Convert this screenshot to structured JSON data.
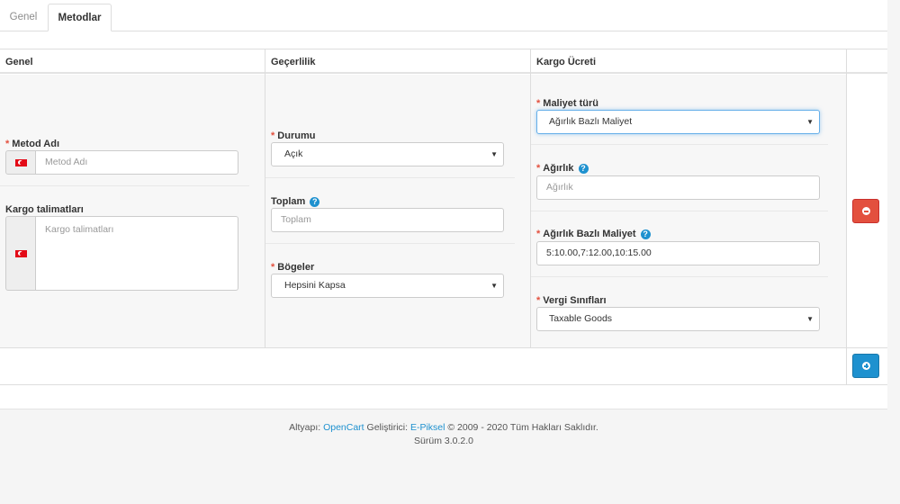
{
  "tabs": [
    {
      "label": "Genel",
      "active": false
    },
    {
      "label": "Metodlar",
      "active": true
    }
  ],
  "table": {
    "headers": [
      "Genel",
      "Geçerlilik",
      "Kargo Ücreti"
    ]
  },
  "genel": {
    "method_name_label": "Metod Adı",
    "method_name_placeholder": "Metod Adı",
    "instructions_label": "Kargo talimatları",
    "instructions_placeholder": "Kargo talimatları"
  },
  "gecerlilik": {
    "status_label": "Durumu",
    "status_value": "Açık",
    "total_label": "Toplam",
    "total_placeholder": "Toplam",
    "regions_label": "Bögeler",
    "regions_value": "Hepsini Kapsa"
  },
  "kargo": {
    "cost_type_label": "Maliyet türü",
    "cost_type_value": "Ağırlık Bazlı Maliyet",
    "weight_label": "Ağırlık",
    "weight_placeholder": "Ağırlık",
    "weight_cost_label": "Ağırlık Bazlı Maliyet",
    "weight_cost_value": "5:10.00,7:12.00,10:15.00",
    "tax_class_label": "Vergi Sınıfları",
    "tax_class_value": "Taxable Goods"
  },
  "icons": {
    "flag": "turkey-flag-icon",
    "help": "question-circle-icon",
    "remove": "minus-circle-icon",
    "add": "plus-circle-icon",
    "select": "caret-down-icon"
  },
  "colors": {
    "danger": "#e3503e",
    "primary": "#1e91cf",
    "required": "#e3503e"
  },
  "footer": {
    "prefix": "Altyapı: ",
    "opencart": "OpenCart",
    "middle": " Geliştirici: ",
    "epiksel": "E-Piksel",
    "suffix": " © 2009 - 2020 Tüm Hakları Saklıdır.",
    "version": "Sürüm 3.0.2.0"
  }
}
